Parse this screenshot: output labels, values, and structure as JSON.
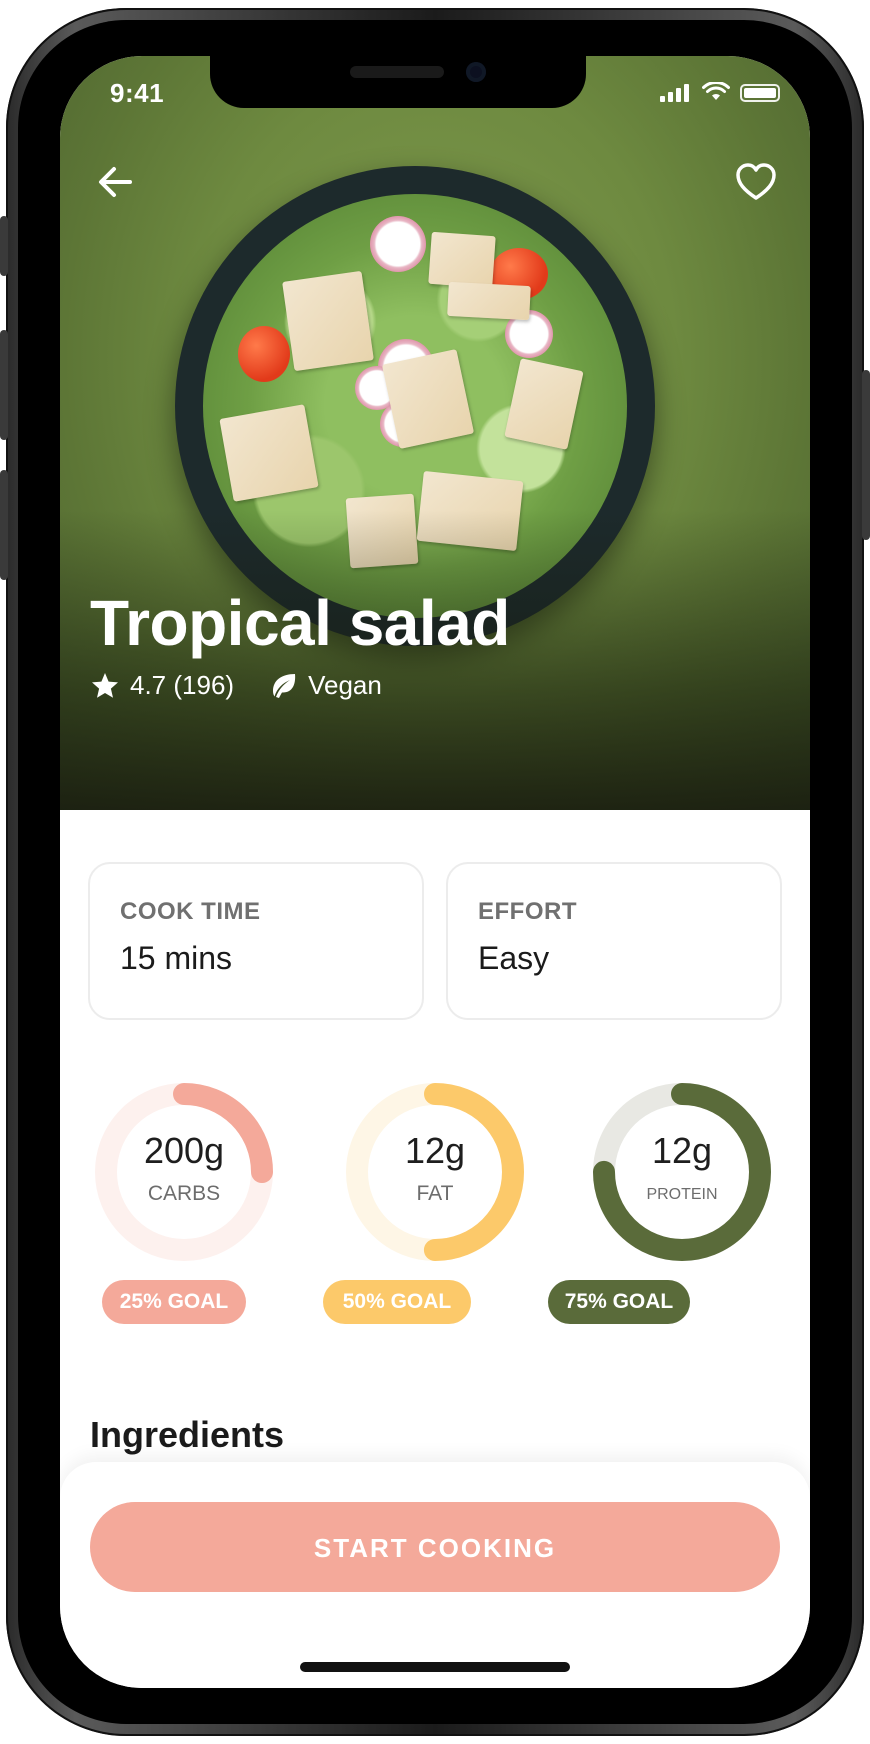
{
  "status_bar": {
    "time": "9:41",
    "icons": [
      "cellular-signal-icon",
      "wifi-icon",
      "battery-icon"
    ]
  },
  "header": {
    "back_icon": "arrow-left-icon",
    "favorite_icon": "heart-outline-icon"
  },
  "recipe": {
    "title": "Tropical salad",
    "rating": "4.7 (196)",
    "rating_icon": "star-icon",
    "diet": "Vegan",
    "diet_icon": "leaf-icon"
  },
  "info_cards": [
    {
      "label": "COOK TIME",
      "value": "15 mins"
    },
    {
      "label": "EFFORT",
      "value": "Easy"
    }
  ],
  "nutrition": [
    {
      "amount": "200g",
      "label": "CARBS",
      "goal": "25% GOAL",
      "goal_fraction": 0.25,
      "color": "#f4a99a",
      "track": "#fdf1ee"
    },
    {
      "amount": "12g",
      "label": "FAT",
      "goal": "50% GOAL",
      "goal_fraction": 0.5,
      "color": "#fcc96a",
      "track": "#fef6e6"
    },
    {
      "amount": "12g",
      "label": "PROTEIN",
      "goal": "75% GOAL",
      "goal_fraction": 0.75,
      "color": "#5a6b3a",
      "track": "#e8e8e3"
    }
  ],
  "sections": {
    "ingredients_title": "Ingredients"
  },
  "actions": {
    "start_cooking": "START COOKING"
  },
  "colors": {
    "accent": "#f4a99a",
    "hero_green": "#6e8a40"
  }
}
